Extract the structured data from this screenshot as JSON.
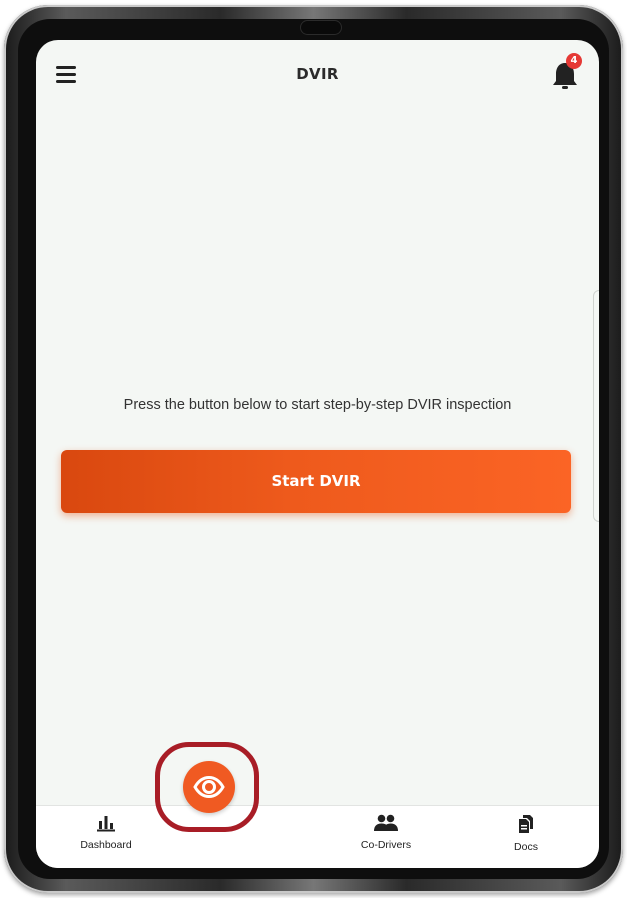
{
  "header": {
    "title": "DVIR",
    "notification_count": "4"
  },
  "main": {
    "prompt": "Press the button below to start step-by-step DVIR inspection",
    "start_button": "Start DVIR"
  },
  "tabs": [
    {
      "label": "Dashboard",
      "icon": "bar-chart-icon"
    },
    {
      "label": "",
      "icon": "eye-icon",
      "active": true
    },
    {
      "label": "Co-Drivers",
      "icon": "people-icon"
    },
    {
      "label": "Docs",
      "icon": "documents-icon"
    }
  ],
  "colors": {
    "accent": "#f05a22",
    "highlight_ring": "#a81d26",
    "badge": "#e53935",
    "screen_bg": "#f4f7f4"
  }
}
